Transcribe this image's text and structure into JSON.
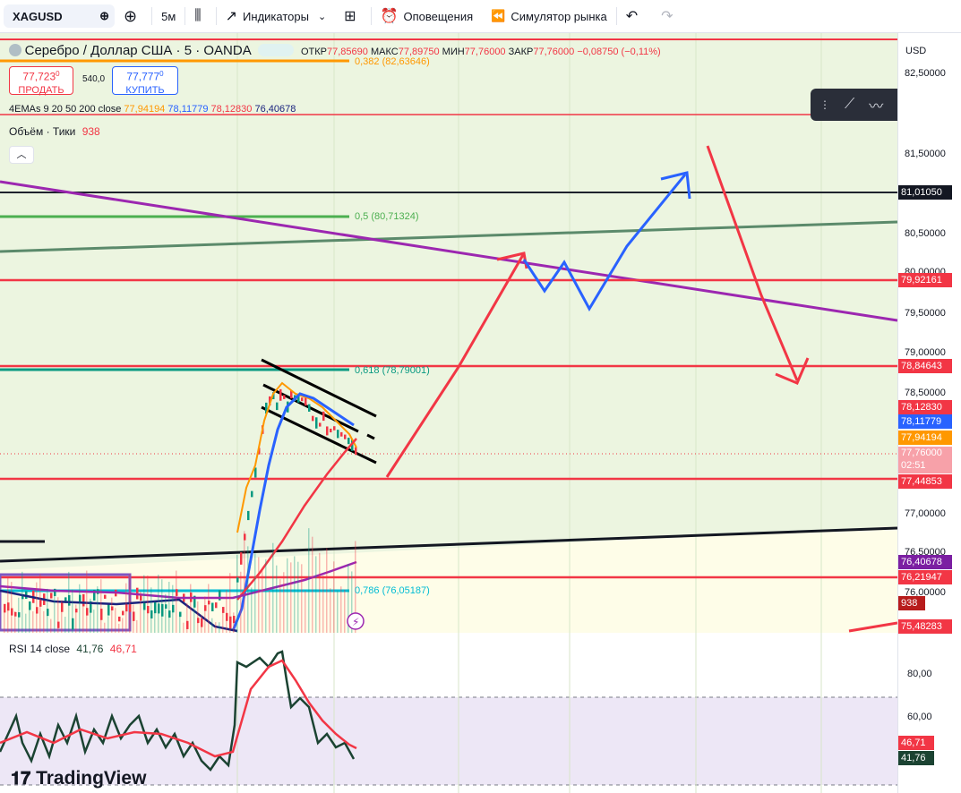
{
  "toolbar": {
    "symbol": "XAGUSD",
    "interval": "5м",
    "indicators": "Индикаторы",
    "alerts": "Оповещения",
    "simulator": "Симулятор рынка"
  },
  "legend": {
    "title": "Серебро / Доллар США · 5 · OANDA",
    "open_label": "ОТКР",
    "open": "77,85690",
    "high_label": "МАКС",
    "high": "77,89750",
    "low_label": "МИН",
    "low": "77,76000",
    "close_label": "ЗАКР",
    "close": "77,76000",
    "change": "−0,08750 (−0,11%)",
    "sell_price": "77,723",
    "sell_sup": "0",
    "sell_label": "ПРОДАТЬ",
    "spread": "540,0",
    "buy_price": "77,777",
    "buy_sup": "0",
    "buy_label": "КУПИТЬ",
    "ema_label": "4EMAs 9 20 50 200 close",
    "ema_values": [
      "77,94194",
      "78,11779",
      "78,12830",
      "76,40678"
    ],
    "volume_label": "Объём · Тики",
    "volume_value": "938",
    "rsi_label": "RSI 14 close",
    "rsi_value": "41,76",
    "rsi_ma_value": "46,71"
  },
  "fib_labels": [
    "0,382 (82,63646)",
    "0,5 (80,71324)",
    "0,618 (78,79001)",
    "0,786 (76,05187)"
  ],
  "axis": {
    "currency": "USD",
    "ticks": [
      "82,50000",
      "81,50000",
      "80,50000",
      "80,00000",
      "79,50000",
      "79,00000",
      "78,50000",
      "77,00000",
      "76,50000",
      "76,00000"
    ],
    "rsi_ticks": [
      "80,00",
      "60,00"
    ]
  },
  "price_labels": [
    "81,01050",
    "79,92161",
    "78,84643",
    "78,12830",
    "78,11779",
    "77,94194",
    "77,76000",
    "02:51",
    "77,44853",
    "76,40678",
    "76,21947",
    "938",
    "75,48283",
    "46,71",
    "41,76"
  ],
  "colors": {
    "support_red": "#f23645",
    "forecast_blue": "#2962ff",
    "trend_purple": "#9c27b0",
    "fib_green": "#4caf50",
    "fib_teal": "#089981",
    "fib_cyan": "#00bcd4"
  },
  "brand": "TradingView"
}
